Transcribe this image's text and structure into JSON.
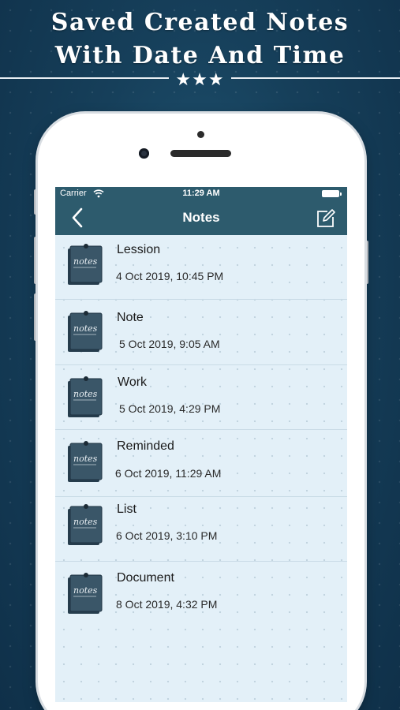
{
  "promo": {
    "line1": "Saved Created Notes",
    "line2": "With Date And Time",
    "stars": "★★★"
  },
  "status_bar": {
    "carrier": "Carrier",
    "time": "11:29 AM"
  },
  "nav": {
    "title": "Notes"
  },
  "notes": [
    {
      "title": "Lession",
      "date": "4 Oct 2019, 10:45 PM"
    },
    {
      "title": "Note",
      "date": "5 Oct 2019, 9:05 AM"
    },
    {
      "title": "Work",
      "date": "5 Oct 2019, 4:29 PM"
    },
    {
      "title": "Reminded",
      "date": "6 Oct 2019, 11:29 AM"
    },
    {
      "title": "List",
      "date": "6 Oct 2019, 3:10 PM"
    },
    {
      "title": "Document",
      "date": "8 Oct 2019, 4:32 PM"
    }
  ],
  "icons": {
    "back": "chevron-left-icon",
    "compose": "compose-icon",
    "note": "notes-pad-icon",
    "wifi": "wifi-icon",
    "battery": "battery-icon"
  },
  "colors": {
    "nav_bar": "#2d5b6d",
    "background": "#163f5a",
    "list_background": "#e3f0f8"
  }
}
